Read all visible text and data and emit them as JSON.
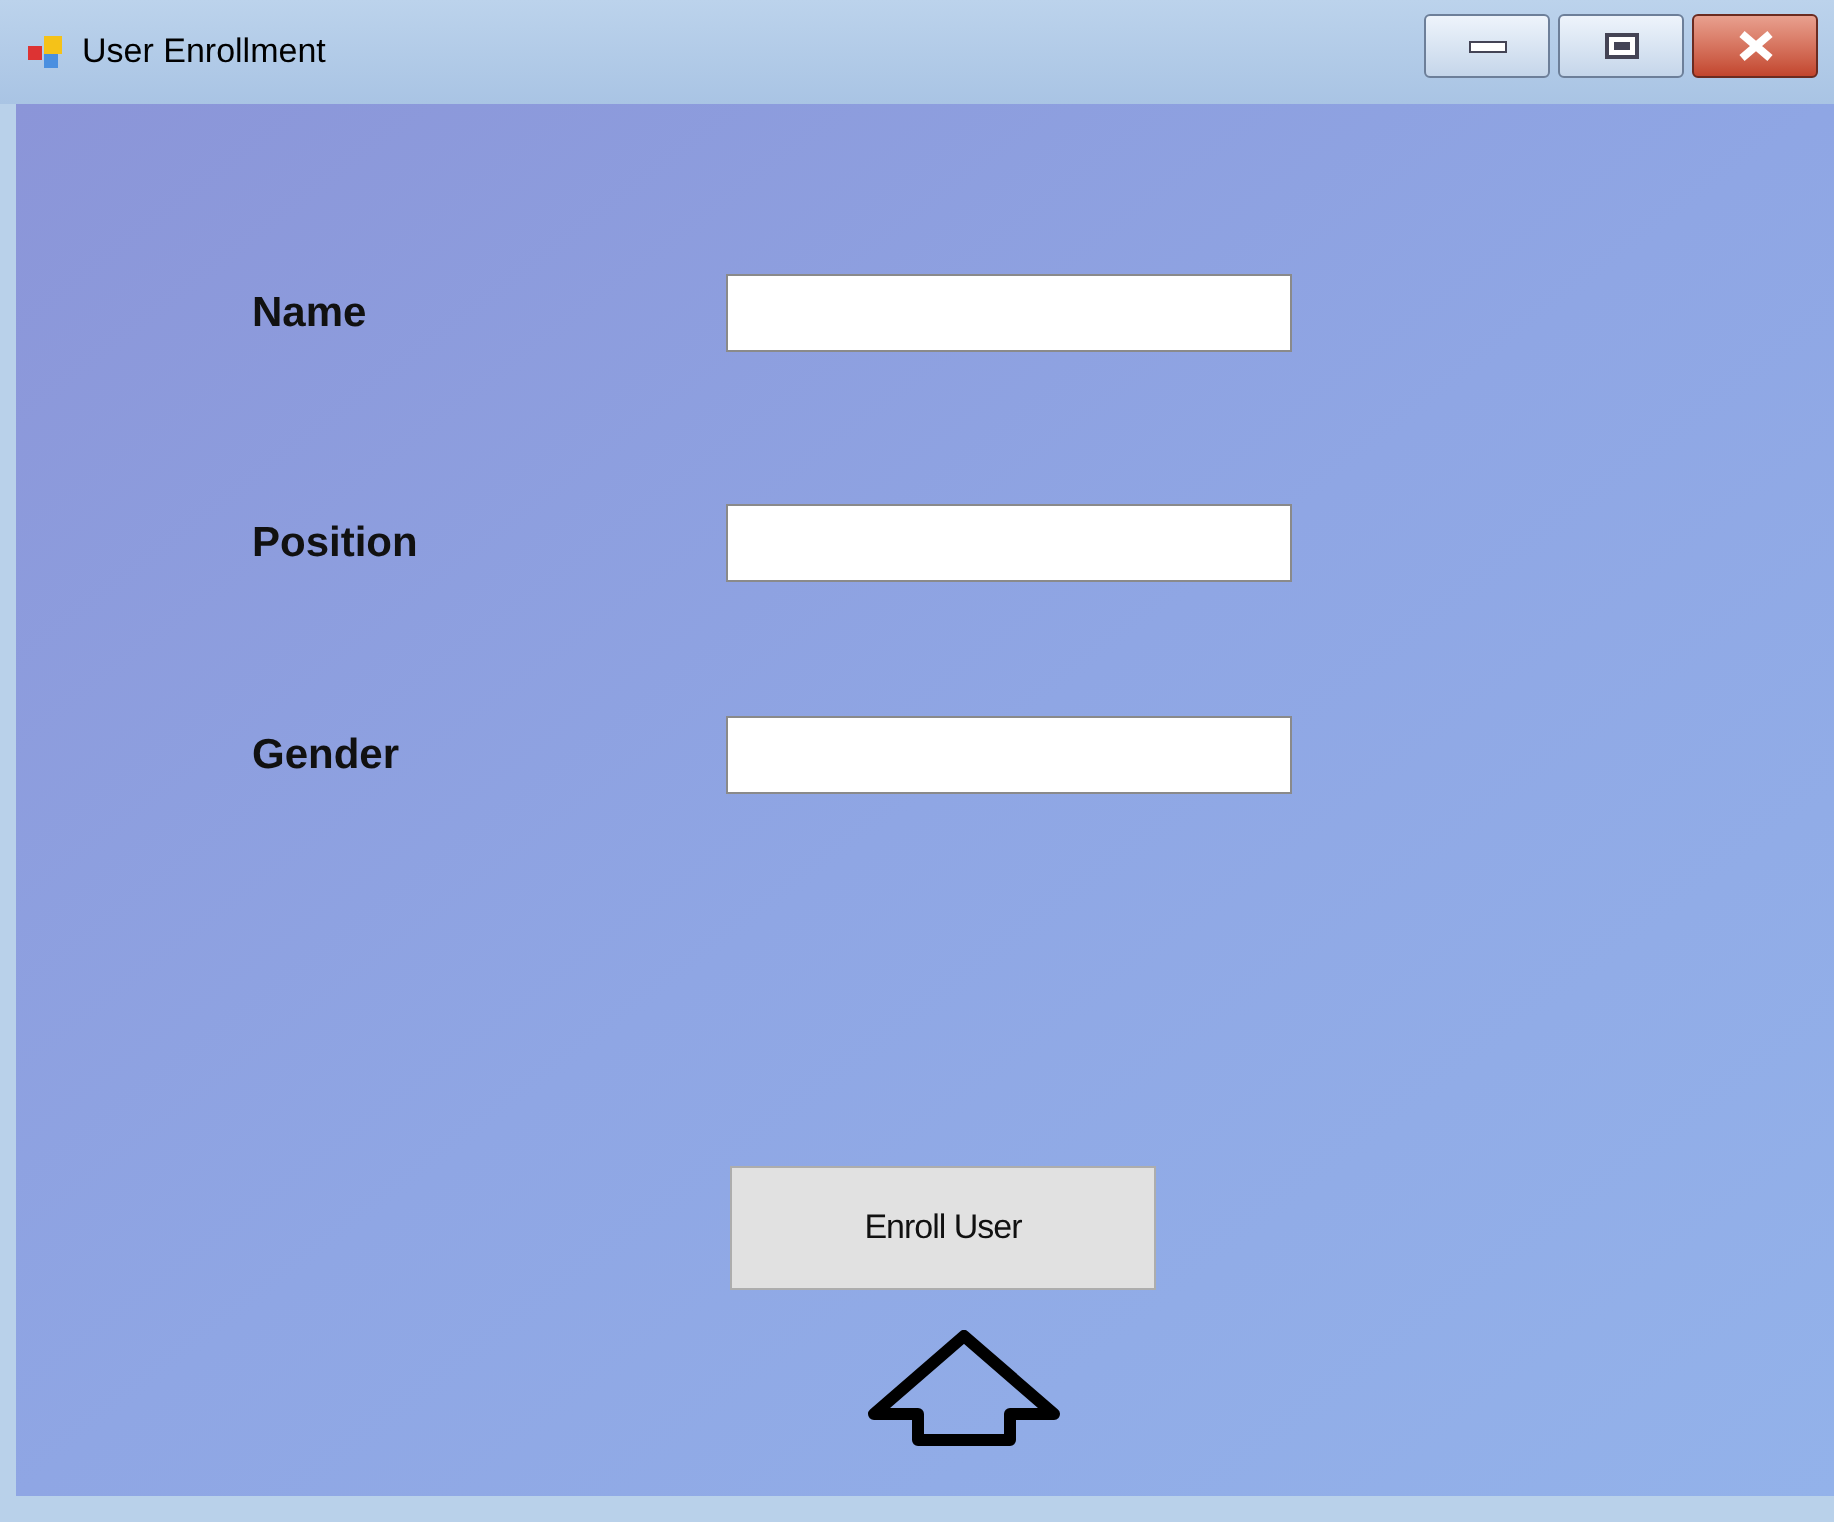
{
  "window": {
    "title": "User Enrollment"
  },
  "fields": [
    {
      "label": "Name"
    },
    {
      "label": "Position"
    },
    {
      "label": "Gender"
    }
  ],
  "button": {
    "label": "Enroll User"
  }
}
